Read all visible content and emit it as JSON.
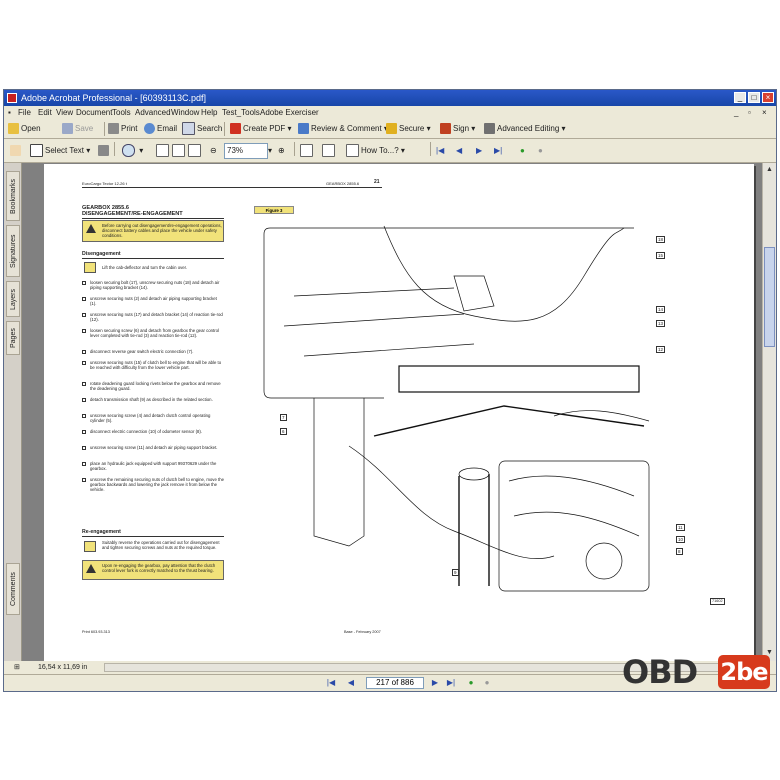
{
  "window": {
    "title": "Adobe Acrobat Professional - [60393113C.pdf]",
    "menu": [
      "File",
      "Edit",
      "View",
      "Document",
      "Tools",
      "Advanced",
      "Window",
      "Help",
      "Test_Tools",
      "Adobe Exerciser"
    ]
  },
  "toolbar1": {
    "open": "Open",
    "save": "Save",
    "print": "Print",
    "email": "Email",
    "search": "Search",
    "create_pdf": "Create PDF",
    "review": "Review & Comment",
    "secure": "Secure",
    "sign": "Sign",
    "advanced_editing": "Advanced Editing"
  },
  "toolbar2": {
    "select_text": "Select Text",
    "zoom": "73%",
    "how_to": "How To...?"
  },
  "sidebar_tabs": [
    "Bookmarks",
    "Signatures",
    "Layers",
    "Pages",
    "Comments"
  ],
  "status": {
    "page_size": "16,54 x 11,69 in",
    "page_indicator": "217 of 886"
  },
  "document": {
    "header_left": "EuroCargo Tector 12-26 t",
    "header_right": "GEARBOX 2855.6",
    "page_number": "21",
    "heading1": "GEARBOX 2855.6",
    "heading2": "DISENGAGEMENT/RE-ENGAGEMENT",
    "warning1": "Before carrying out disengagement/re-engagement operations, disconnect battery cables and place the vehicle under safety conditions.",
    "section_disengagement": "Disengagement",
    "lift_cab": "Lift the cab-deflector and turn the cabin over.",
    "steps": [
      "loosen securing bolt (17), unscrew securing nuts (18) and detach air piping supporting bracket (14).",
      "unscrew securing nuts (2) and detach air piping supporting bracket (1).",
      "unscrew securing nuts (17) and detach bracket (14) of reaction tie-rod (12).",
      "loosen securing screw (6) and detach from gearbox the gear control lever completed with tie-rod (3) and reaction tie-rod (12).",
      "disconnect reverse gear switch electric connection (7).",
      "unscrew securing nuts (15) of clutch bell to engine that will be able to be reached with difficulty from the lower vehicle part.",
      "rotate deadening guard locking rivets below the gearbox and remove the deadening guard.",
      "detach transmission shaft (9) as described in the related section.",
      "unscrew securing screw (4) and detach clutch control operating cylinder (5).",
      "disconnect electric connection (10) of odometer sensor (8).",
      "unscrew securing screw (11) and detach air piping support bracket.",
      "place an hydraulic jack equipped with support 99370629 under the gearbox.",
      "unscrew the remaining securing nuts of clutch bell to engine, move the gearbox backwards and lowering the jack remove it from below the vehicle."
    ],
    "section_reengagement": "Re-engagement",
    "reengage_text": "Suitably reverse the operations carried out for disengagement and tighten securing screws and nuts at the required torque.",
    "warning2": "Upon re-engaging the gearbox, pay attention that the clutch control lever fork is correctly matched to the thrust bearing.",
    "figure_label": "Figure 3",
    "callouts": [
      "18",
      "15",
      "14",
      "13",
      "12",
      "7",
      "6",
      "11",
      "10",
      "8",
      "9"
    ],
    "figure_code": "71602",
    "footer_left": "Print 603.93.313",
    "footer_center": "Base - February 2007"
  },
  "logo": {
    "text_left": "OBD",
    "text_right": "2be"
  }
}
